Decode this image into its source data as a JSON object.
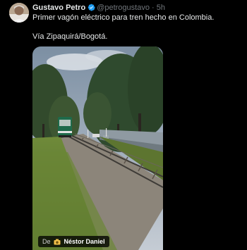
{
  "tweet": {
    "author_name": "Gustavo Petro",
    "handle": "@petrogustavo",
    "separator": "·",
    "time": "5h",
    "text_line1": "Primer vagón eléctrico para tren hecho en Colombia.",
    "text_line2": "Vía Zipaquirá/Bogotá."
  },
  "media": {
    "credit_prefix": "De",
    "credit_author": "Néstor Daniel"
  },
  "colors": {
    "background": "#000000",
    "text": "#e7e9ea",
    "secondary": "#71767b",
    "verified": "#1d9bf0"
  },
  "icons": {
    "verified": "verified-badge-icon",
    "credit": "camera-icon"
  }
}
